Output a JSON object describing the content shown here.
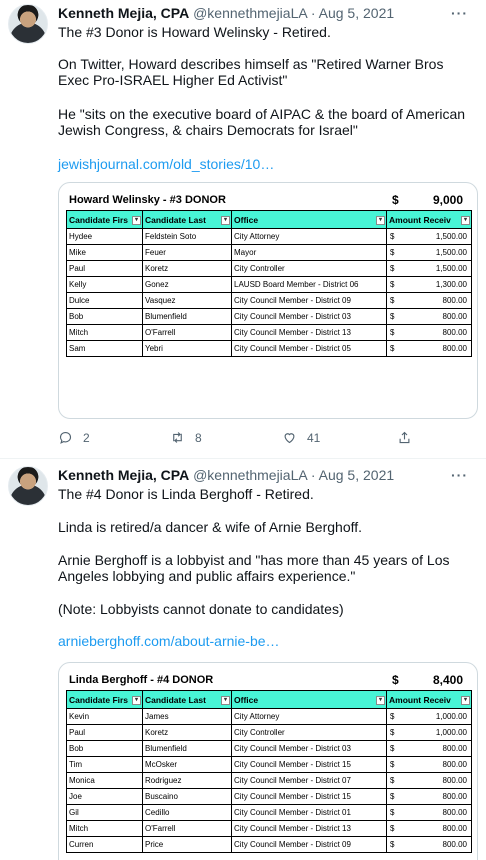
{
  "tweets": [
    {
      "author_name": "Kenneth Mejia, CPA",
      "handle": "@kennethmejiaLA",
      "separator": "·",
      "date": "Aug 5, 2021",
      "more": "···",
      "line1": "The #3 Donor is Howard Welinsky - Retired.",
      "para2": "On Twitter, Howard describes himself as \"Retired Warner Bros Exec Pro-ISRAEL Higher Ed Activist\"",
      "para3": "He \"sits on the executive board of AIPAC & the board of American Jewish Congress, & chairs Democrats for Israel\"",
      "link": "jewishjournal.com/old_stories/10…",
      "sheet": {
        "title": "Howard Welinsky - #3 DONOR",
        "currency": "$",
        "total": "9,000",
        "headers": [
          "Candidate Firs",
          "Candidate Last",
          "Office",
          "Amount Receiv"
        ],
        "rows": [
          [
            "Hydee",
            "Feldstein Soto",
            "City Attorney",
            "$",
            "1,500.00"
          ],
          [
            "Mike",
            "Feuer",
            "Mayor",
            "$",
            "1,500.00"
          ],
          [
            "Paul",
            "Koretz",
            "City Controller",
            "$",
            "1,500.00"
          ],
          [
            "Kelly",
            "Gonez",
            "LAUSD Board Member - District 06",
            "$",
            "1,300.00"
          ],
          [
            "Dulce",
            "Vasquez",
            "City Council Member - District 09",
            "$",
            "800.00"
          ],
          [
            "Bob",
            "Blumenfield",
            "City Council Member - District 03",
            "$",
            "800.00"
          ],
          [
            "Mitch",
            "O'Farrell",
            "City Council Member - District 13",
            "$",
            "800.00"
          ],
          [
            "Sam",
            "Yebri",
            "City Council Member - District 05",
            "$",
            "800.00"
          ]
        ]
      },
      "replies": "2",
      "retweets": "8",
      "likes": "41"
    },
    {
      "author_name": "Kenneth Mejia, CPA",
      "handle": "@kennethmejiaLA",
      "separator": "·",
      "date": "Aug 5, 2021",
      "more": "···",
      "line1": "The #4 Donor is Linda Berghoff - Retired.",
      "para2": "Linda is retired/a dancer & wife of Arnie Berghoff.",
      "para3": "Arnie Berghoff is a lobbyist and \"has more than 45 years of Los Angeles lobbying and public affairs experience.\"",
      "para4": "(Note: Lobbyists cannot donate to candidates)",
      "link": "arnieberghoff.com/about-arnie-be…",
      "sheet": {
        "title": "Linda Berghoff - #4 DONOR",
        "currency": "$",
        "total": "8,400",
        "headers": [
          "Candidate Firs",
          "Candidate Last",
          "Office",
          "Amount Receiv"
        ],
        "rows": [
          [
            "Kevin",
            "James",
            "City Attorney",
            "$",
            "1,000.00"
          ],
          [
            "Paul",
            "Koretz",
            "City Controller",
            "$",
            "1,000.00"
          ],
          [
            "Bob",
            "Blumenfield",
            "City Council Member - District 03",
            "$",
            "800.00"
          ],
          [
            "Tim",
            "McOsker",
            "City Council Member - District 15",
            "$",
            "800.00"
          ],
          [
            "Monica",
            "Rodriguez",
            "City Council Member - District 07",
            "$",
            "800.00"
          ],
          [
            "Joe",
            "Buscaino",
            "City Council Member - District 15",
            "$",
            "800.00"
          ],
          [
            "Gil",
            "Cedillo",
            "City Council Member - District 01",
            "$",
            "800.00"
          ],
          [
            "Mitch",
            "O'Farrell",
            "City Council Member - District 13",
            "$",
            "800.00"
          ],
          [
            "Curren",
            "Price",
            "City Council Member - District 09",
            "$",
            "800.00"
          ]
        ]
      }
    }
  ]
}
